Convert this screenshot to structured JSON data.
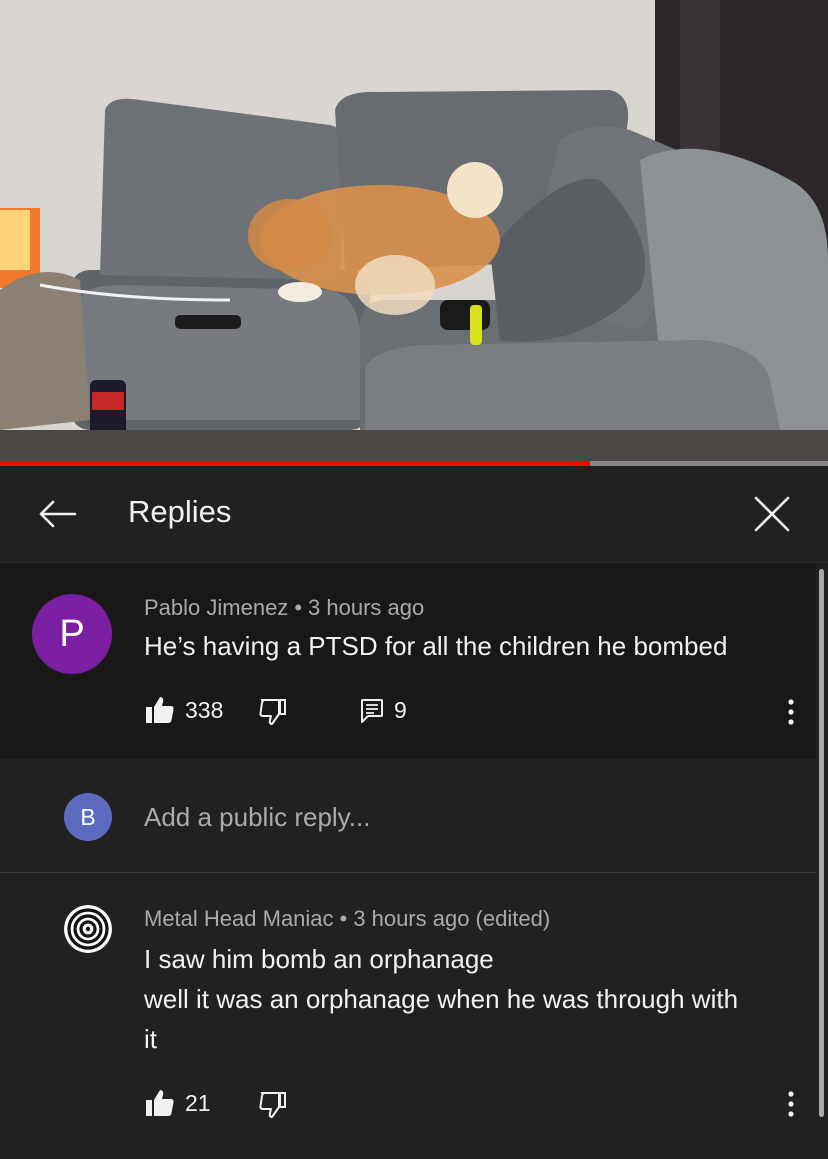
{
  "video": {
    "progress_fraction": 0.713
  },
  "header": {
    "title": "Replies"
  },
  "icons": {
    "back": "arrow-left-icon",
    "close": "close-icon",
    "like": "thumbs-up-icon",
    "dislike": "thumbs-down-icon",
    "replies": "comment-icon",
    "more": "more-vert-icon"
  },
  "colors": {
    "background": "#212121",
    "highlight": "#181818",
    "progress": "#ff0000",
    "avatar_p": "#7b1fa2",
    "avatar_b": "#5c6bc0"
  },
  "comment": {
    "avatar_letter": "P",
    "author": "Pablo Jimenez",
    "time": "3 hours ago",
    "text": "He’s having a PTSD for all the children he bombed",
    "likes": "338",
    "reply_count": "9"
  },
  "add_reply": {
    "avatar_letter": "B",
    "placeholder": "Add a public reply..."
  },
  "reply": {
    "author": "Metal Head Maniac",
    "time": "3 hours ago (edited)",
    "lines": [
      "I saw him bomb an orphanage",
      "well it was an orphanage when he was through with",
      "it"
    ],
    "likes": "21"
  }
}
